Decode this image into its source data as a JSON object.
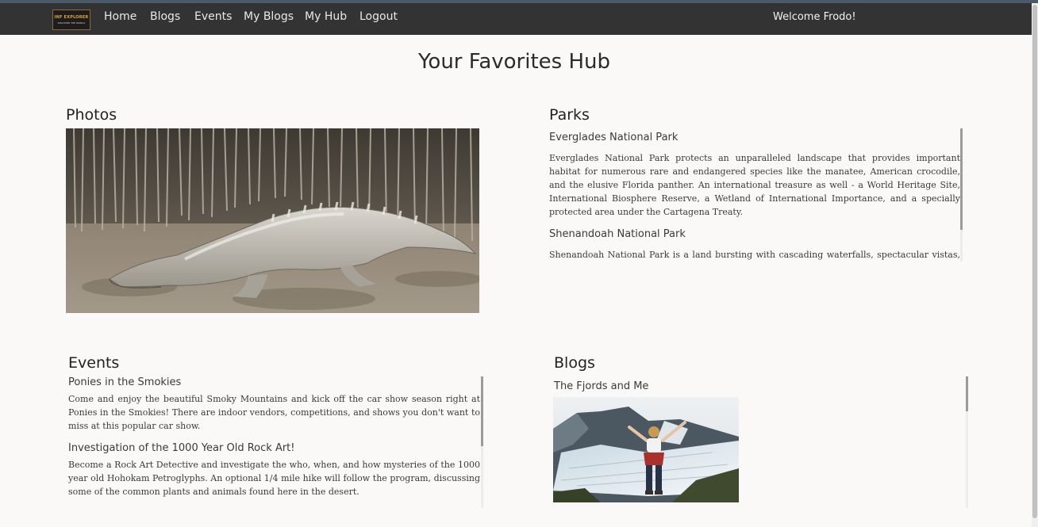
{
  "nav": {
    "logo_text": "INF EXPLORER",
    "logo_subtext": "DISCOVER THE WORLD",
    "links": [
      "Home",
      "Blogs",
      "Events",
      "My Blogs",
      "My Hub",
      "Logout"
    ],
    "welcome": "Welcome Frodo!"
  },
  "page_title": "Your Favorites Hub",
  "photos": {
    "title": "Photos",
    "image_alt": "crocodile-on-mudflat"
  },
  "parks": {
    "title": "Parks",
    "items": [
      {
        "name": "Everglades National Park",
        "description": "Everglades National Park protects an unparalleled landscape that provides important habitat for numerous rare and endangered species like the manatee, American crocodile, and the elusive Florida panther. An international treasure as well - a World Heritage Site, International Biosphere Reserve, a Wetland of International Importance, and a specially protected area under the Cartagena Treaty."
      },
      {
        "name": "Shenandoah National Park",
        "description": "Shenandoah National Park is a land bursting with cascading waterfalls, spectacular vistas, fields of"
      }
    ]
  },
  "events": {
    "title": "Events",
    "items": [
      {
        "name": "Ponies in the Smokies",
        "description": "Come and enjoy the beautiful Smoky Mountains and kick off the car show season right at Ponies in the Smokies! There are indoor vendors, competitions, and shows you don't want to miss at this popular car show."
      },
      {
        "name": "Investigation of the 1000 Year Old Rock Art!",
        "description": "Become a Rock Art Detective and investigate the who, when, and how mysteries of the 1000 year old Hohokam Petroglyphs. An optional 1/4 mile hike will follow the program, discussing some of the common plants and animals found here in the desert."
      }
    ]
  },
  "blogs": {
    "title": "Blogs",
    "items": [
      {
        "name": "The Fjords and Me",
        "image_alt": "hiker-at-glacier"
      }
    ]
  }
}
